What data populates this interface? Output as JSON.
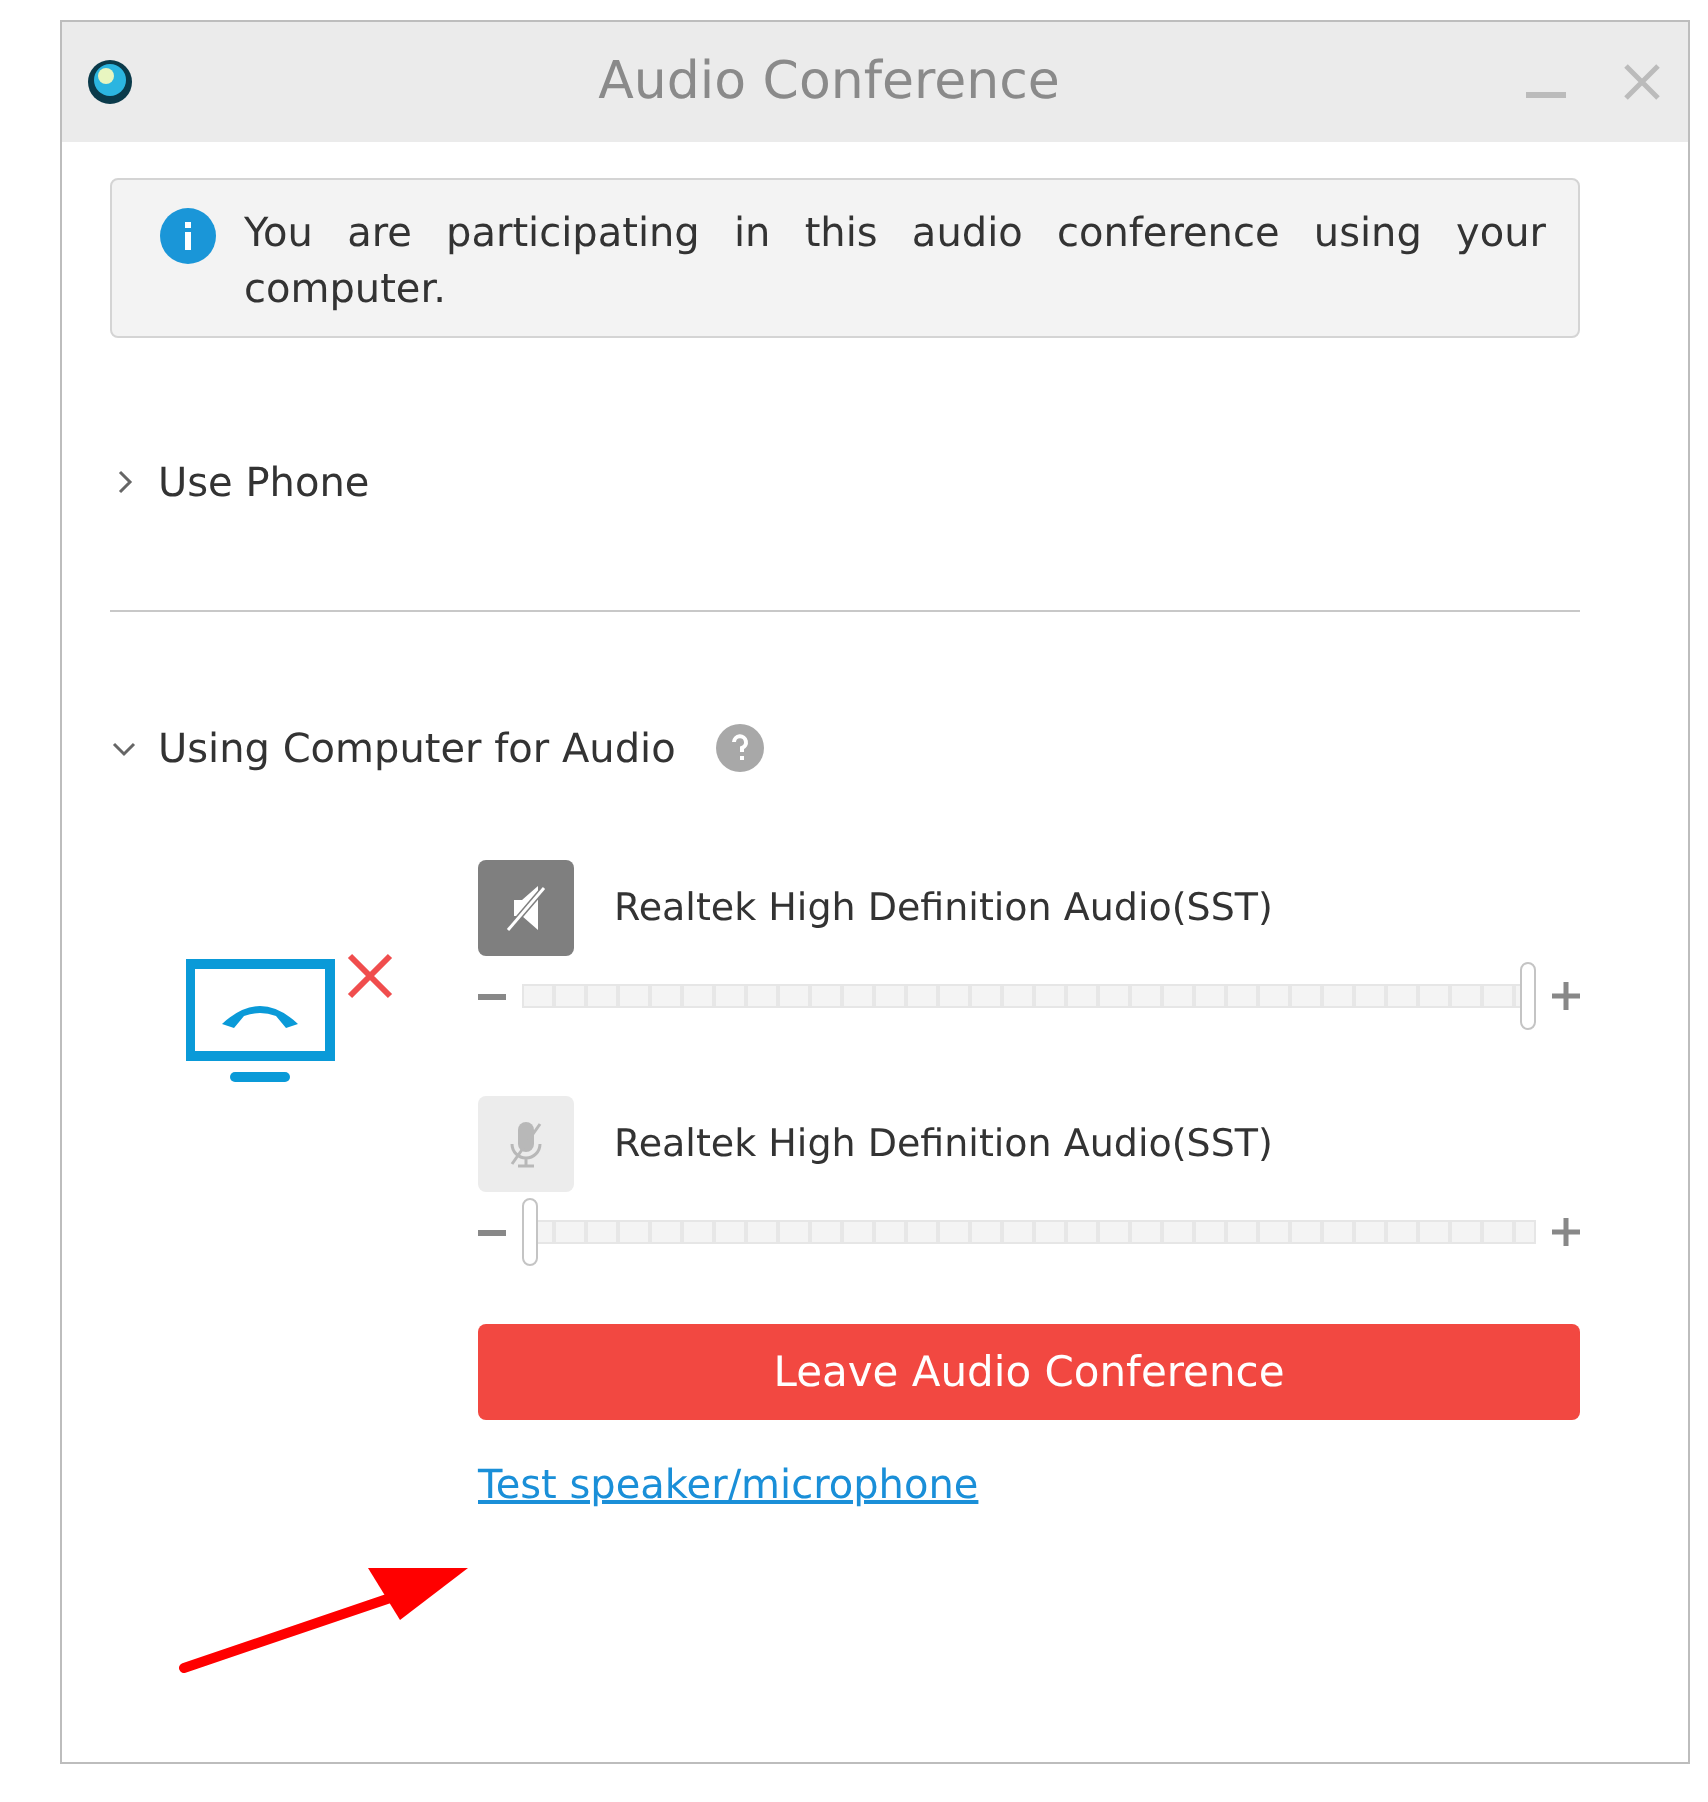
{
  "window": {
    "title": "Audio Conference"
  },
  "notice": {
    "text": "You are participating in this audio conference using your computer."
  },
  "sections": [
    {
      "title": "Use Phone",
      "expanded": false
    },
    {
      "title": "Using Computer for Audio",
      "expanded": true
    }
  ],
  "devices": [
    {
      "kind": "speaker",
      "name": "Realtek High Definition Audio(SST)",
      "level": 1
    },
    {
      "kind": "microphone",
      "name": "Realtek High Definition Audio(SST)",
      "level": 0
    }
  ],
  "leave_button": "Leave Audio Conference",
  "test_link": "Test speaker/microphone"
}
